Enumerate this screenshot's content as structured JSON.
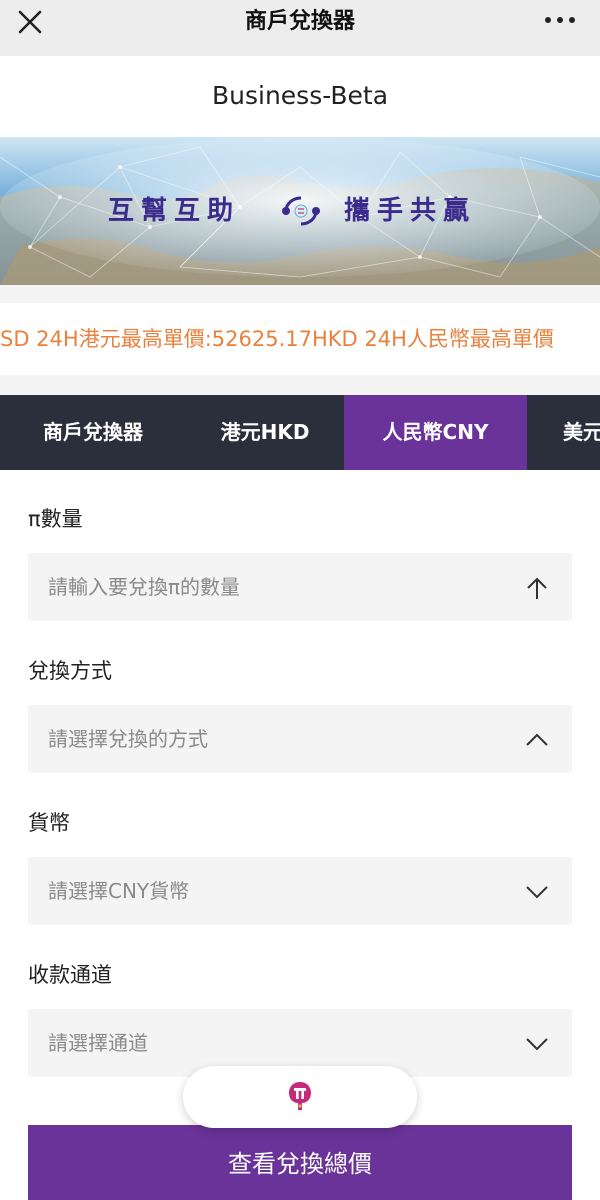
{
  "header": {
    "title": "商戶兌換器",
    "close_icon": "close-icon",
    "more_icon": "more-horizontal-icon"
  },
  "brand": {
    "name": "Business-Beta"
  },
  "banner": {
    "left_text": "互幫互助",
    "right_text": "攜手共贏",
    "logo_icon": "exchange-arrows-logo"
  },
  "ticker": {
    "text": "SD  24H港元最高單價:52625.17HKD  24H人民幣最高單價"
  },
  "tabs": [
    {
      "label": "商戶兌換器",
      "active": false
    },
    {
      "label": "港元HKD",
      "active": false
    },
    {
      "label": "人民幣CNY",
      "active": true
    },
    {
      "label": "美元",
      "active": false
    }
  ],
  "form": {
    "quantity": {
      "label": "π數量",
      "placeholder": "請輸入要兌換π的數量",
      "icon": "arrow-up-icon"
    },
    "method": {
      "label": "兌換方式",
      "placeholder": "請選擇兌換的方式",
      "icon": "chevron-up-icon"
    },
    "currency": {
      "label": "貨幣",
      "placeholder": "請選擇CNY貨幣",
      "icon": "chevron-down-icon"
    },
    "channel": {
      "label": "收款通道",
      "placeholder": "請選擇通道",
      "icon": "chevron-down-icon"
    }
  },
  "floating_button": {
    "icon": "pi-app-logo-icon"
  },
  "submit": {
    "label": "查看兌換總價"
  },
  "colors": {
    "accent": "#6a3399",
    "tab_bar": "#2b2f3b",
    "ticker": "#e8813d",
    "banner_text": "#3a2b8c"
  }
}
